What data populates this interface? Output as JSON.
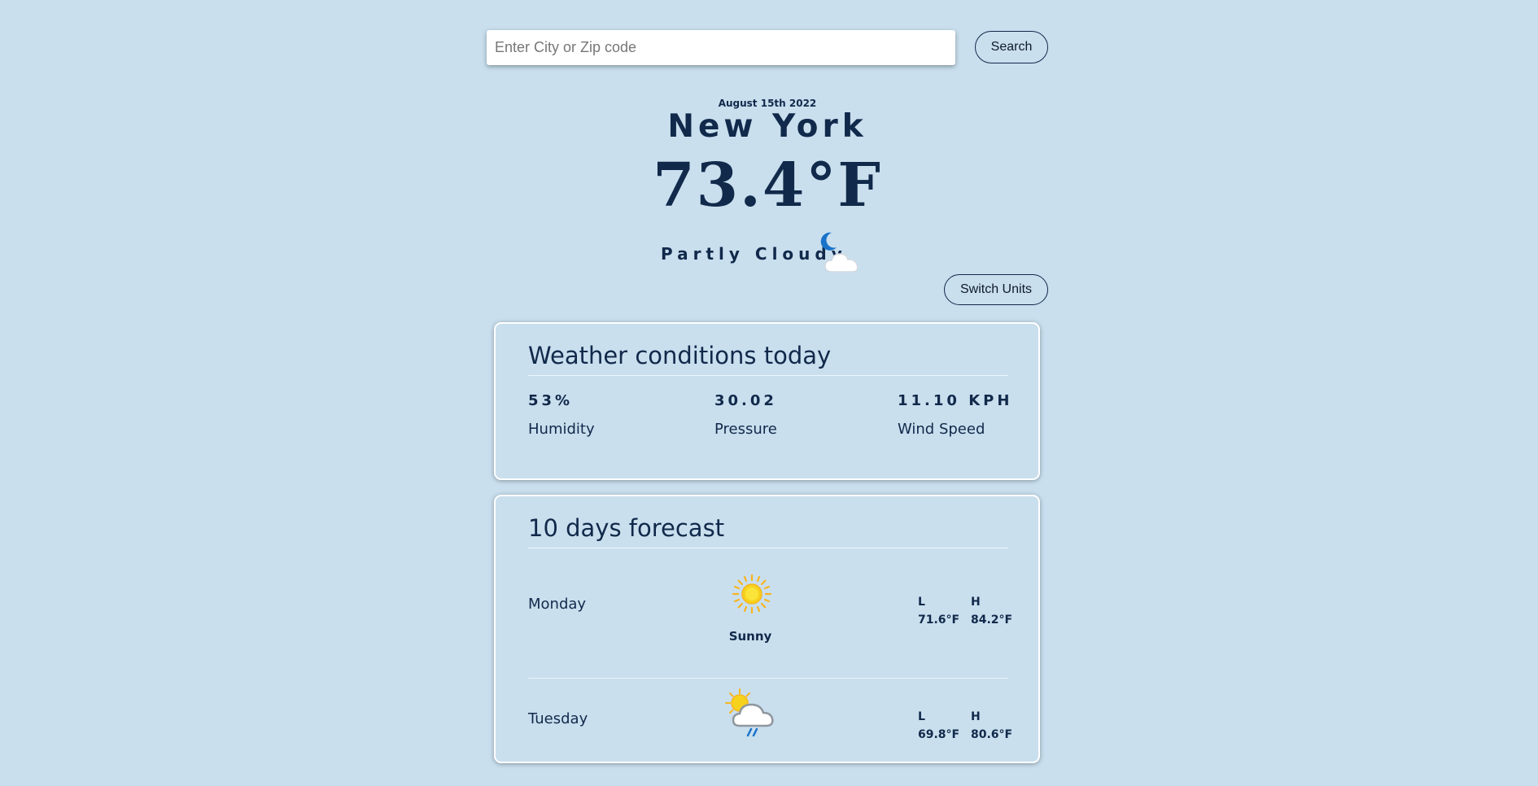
{
  "search": {
    "placeholder": "Enter City or Zip code",
    "value": "",
    "button_label": "Search"
  },
  "current": {
    "date": "August 15th 2022",
    "city": "New York",
    "temperature": "73.4°F",
    "condition": "Partly Cloudy",
    "condition_icon": "moon-cloud-icon"
  },
  "switch_units_label": "Switch Units",
  "today": {
    "title": "Weather conditions today",
    "stats": [
      {
        "value": "53%",
        "label": "Humidity"
      },
      {
        "value": "30.02",
        "label": "Pressure"
      },
      {
        "value": "11.10 KPH",
        "label": "Wind Speed"
      }
    ]
  },
  "forecast": {
    "title": "10 days forecast",
    "low_label": "L",
    "high_label": "H",
    "days": [
      {
        "day": "Monday",
        "icon": "sun-icon",
        "desc": "Sunny",
        "low": "71.6°F",
        "high": "84.2°F"
      },
      {
        "day": "Tuesday",
        "icon": "sun-cloud-rain-icon",
        "desc": "",
        "low": "69.8°F",
        "high": "80.6°F"
      }
    ]
  },
  "colors": {
    "background": "#c9dfee",
    "text": "#11294a",
    "card_border": "#ffffff",
    "sun": "#f7c520",
    "moon": "#1a73c9"
  }
}
